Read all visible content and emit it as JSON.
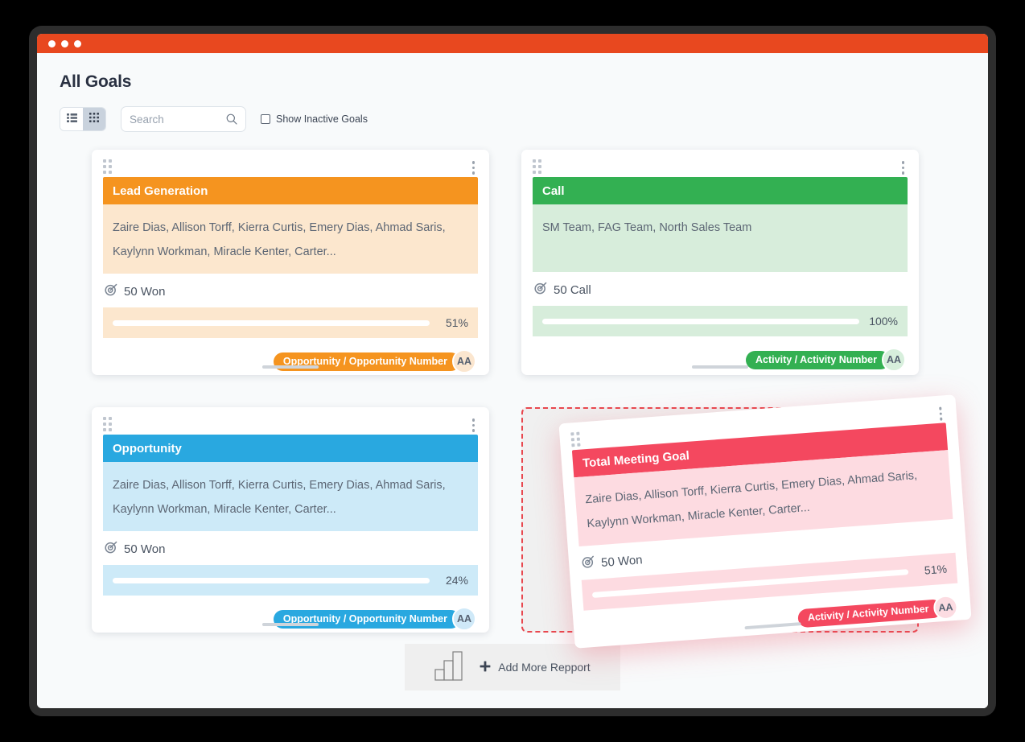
{
  "window": {
    "titlebar_color": "#e8481f",
    "traffic_lights": [
      "dot-1",
      "dot-2",
      "dot-3"
    ]
  },
  "header": {
    "title": "All Goals"
  },
  "toolbar": {
    "view_list_icon": "list-view-icon",
    "view_grid_icon": "grid-view-icon",
    "active_view": "grid",
    "search": {
      "placeholder": "Search",
      "value": "",
      "icon": "search-icon"
    },
    "inactive_checkbox": {
      "label": "Show Inactive Goals",
      "checked": false
    }
  },
  "cards": [
    {
      "id": "lead-generation",
      "title": "Lead Generation",
      "members": "Zaire Dias, Allison Torff, Kierra Curtis, Emery Dias, Ahmad Saris, Kaylynn Workman, Miracle Kenter, Carter...",
      "metric": "50 Won",
      "metric_icon": "target-icon",
      "progress_label": "51%",
      "progress_value": 51,
      "badge": "Opportunity / Opportunity Number",
      "avatar": "AA",
      "accent": "#f5941f",
      "tint": "#fce7ce",
      "avatar_bg": "#fbe6cf"
    },
    {
      "id": "call",
      "title": "Call",
      "members": "SM Team, FAG Team, North Sales Team",
      "metric": "50 Call",
      "metric_icon": "target-icon",
      "progress_label": "100%",
      "progress_value": 100,
      "badge": "Activity / Activity Number",
      "avatar": "AA",
      "accent": "#33b052",
      "tint": "#d7eddb",
      "avatar_bg": "#d7efdc"
    },
    {
      "id": "opportunity",
      "title": "Opportunity",
      "members": "Zaire Dias, Allison Torff, Kierra Curtis, Emery Dias, Ahmad Saris, Kaylynn Workman, Miracle Kenter, Carter...",
      "metric": "50 Won",
      "metric_icon": "target-icon",
      "progress_label": "24%",
      "progress_value": 24,
      "badge": "Opportunity / Opportunity Number",
      "avatar": "AA",
      "accent": "#29a8e0",
      "tint": "#cdeaf8",
      "avatar_bg": "#cfe9f8"
    }
  ],
  "dragged_card": {
    "id": "total-meeting-goal",
    "title": "Total Meeting Goal",
    "members": "Zaire Dias, Allison Torff, Kierra Curtis, Emery Dias, Ahmad Saris, Kaylynn Workman, Miracle Kenter, Carter...",
    "metric": "50 Won",
    "metric_icon": "target-icon",
    "progress_label": "51%",
    "progress_value": 51,
    "badge": "Activity / Activity Number",
    "avatar": "AA",
    "accent": "#f4485f",
    "tint": "#fddbe1",
    "avatar_bg": "#fcdce2",
    "cursor_icon": "pointing-hand-cursor"
  },
  "drop_zone": {
    "border_color": "#e8484f",
    "fill_color": "#f0f0f0"
  },
  "add_report": {
    "label": "Add More Repport",
    "plus_icon": "plus-icon",
    "chart_icon": "bar-chart-icon"
  }
}
